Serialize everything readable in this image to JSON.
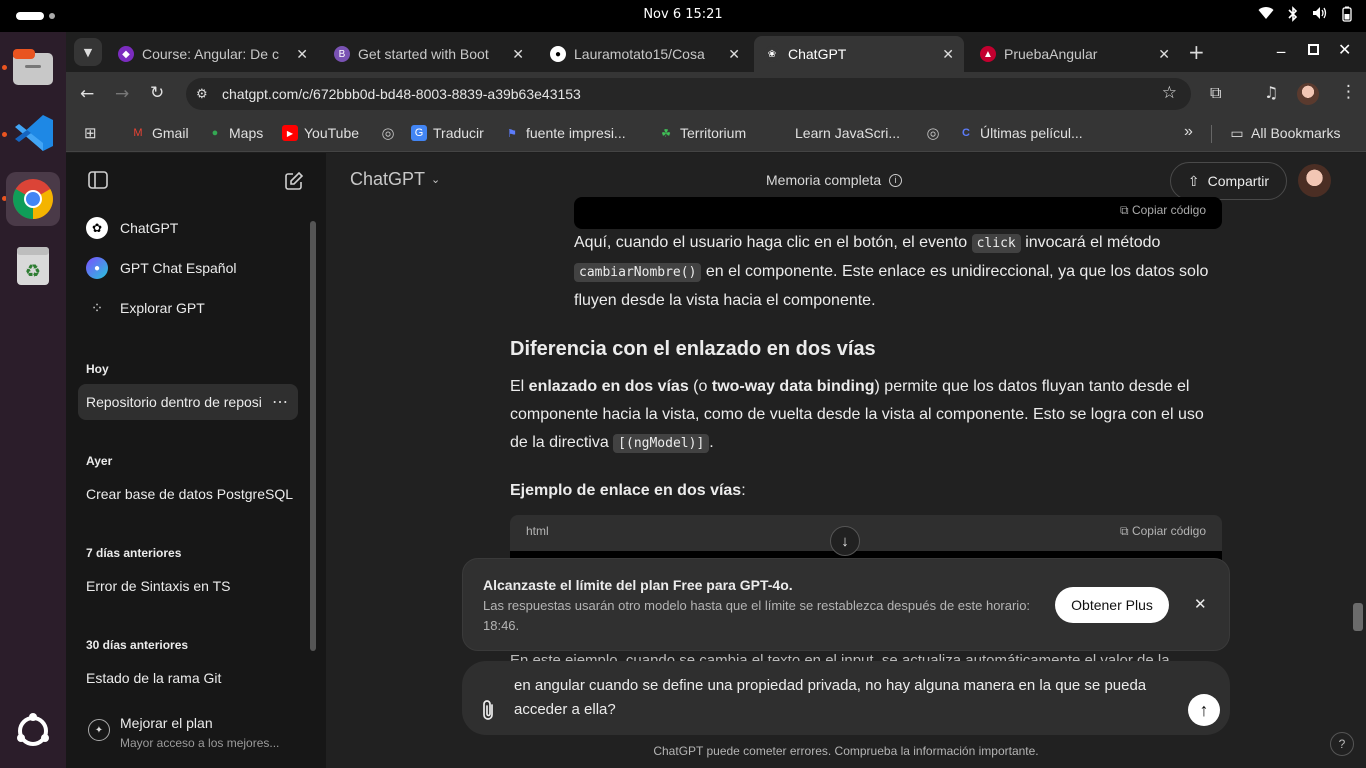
{
  "system": {
    "clock": "Nov 6  15:21"
  },
  "browser": {
    "tabs": [
      {
        "title": "Course: Angular: De c",
        "fav_color": "#7b2cbf",
        "fav_glyph": "◆"
      },
      {
        "title": "Get started with Boot",
        "fav_color": "#7952b3",
        "fav_glyph": "B"
      },
      {
        "title": "Lauramotato15/Cosa",
        "fav_color": "#ffffff",
        "fav_glyph": "●"
      },
      {
        "title": "ChatGPT",
        "fav_color": "#353535",
        "fav_glyph": "❀"
      },
      {
        "title": "PruebaAngular",
        "fav_color": "#c3002f",
        "fav_glyph": "▲"
      }
    ],
    "url": "chatgpt.com/c/672bbb0d-bd48-8003-8839-a39b63e43153",
    "bookmarks": [
      {
        "label": "Gmail",
        "icon_color": "#ea4335",
        "glyph": "M"
      },
      {
        "label": "Maps",
        "icon_color": "#34a853",
        "glyph": "●"
      },
      {
        "label": "YouTube",
        "icon_color": "#ff0000",
        "glyph": "▶"
      },
      {
        "label": "",
        "icon_color": "#9aa0a6",
        "glyph": "◎"
      },
      {
        "label": "Traducir",
        "icon_color": "#4285f4",
        "glyph": "G"
      },
      {
        "label": "fuente impresi...",
        "icon_color": "#3b5bdb",
        "glyph": "⚑"
      },
      {
        "label": "Territorium",
        "icon_color": "#2f9e44",
        "glyph": "☘"
      },
      {
        "label": "Learn JavaScri...",
        "icon_color": "#353535",
        "glyph": ""
      },
      {
        "label": "",
        "icon_color": "#9aa0a6",
        "glyph": "◎"
      },
      {
        "label": "Últimas películ...",
        "icon_color": "#3b5bdb",
        "glyph": "C"
      }
    ],
    "all_bookmarks": "All Bookmarks"
  },
  "sidebar": {
    "nav": [
      {
        "label": "ChatGPT"
      },
      {
        "label": "GPT Chat Español"
      },
      {
        "label": "Explorar GPT"
      }
    ],
    "sections": [
      {
        "heading": "Hoy",
        "items": [
          "Repositorio dentro de reposi"
        ]
      },
      {
        "heading": "Ayer",
        "items": [
          "Crear base de datos PostgreSQL"
        ]
      },
      {
        "heading": "7 días anteriores",
        "items": [
          "Error de Sintaxis en TS"
        ]
      },
      {
        "heading": "30 días anteriores",
        "items": [
          "Estado de la rama Git"
        ]
      }
    ],
    "upgrade": {
      "title": "Mejorar el plan",
      "subtitle": "Mayor acceso a los mejores..."
    }
  },
  "header": {
    "model": "ChatGPT",
    "memory": "Memoria completa",
    "share": "Compartir"
  },
  "content": {
    "copy_code": "Copiar código",
    "para1_a": "Aquí, cuando el usuario haga clic en el botón, el evento ",
    "para1_code1": "click",
    "para1_b": " invocará el método",
    "para1_code2": "cambiarNombre()",
    "para1_c": " en el componente. Este enlace es unidireccional, ya que los datos solo fluyen desde la vista hacia el componente.",
    "heading": "Diferencia con el enlazado en dos vías",
    "para2_a": "El ",
    "para2_b1": "enlazado en dos vías",
    "para2_b": " (o ",
    "para2_b2": "two-way data binding",
    "para2_c": ") permite que los datos fluyan tanto desde el componente hacia la vista, como de vuelta desde la vista al componente. Esto se logra con el uso de la directiva ",
    "para2_code": "[(ngModel)]",
    "para2_d": ".",
    "example_label": "Ejemplo de enlace en dos vías",
    "example_colon": ":",
    "code_lang": "html",
    "partial_line": "En este ejemplo, cuando se cambia el texto en el input, se actualiza automáticamente el valor de la propiedad"
  },
  "limit_banner": {
    "title": "Alcanzaste el límite del plan Free para GPT-4o.",
    "body": "Las respuestas usarán otro modelo hasta que el límite se restablezca después de este horario: 18:46.",
    "cta": "Obtener Plus"
  },
  "composer": {
    "text": "en angular cuando se define una propiedad privada, no hay alguna manera en la que se pueda acceder a ella?"
  },
  "footer": {
    "disclaimer": "ChatGPT puede cometer errores. Comprueba la información importante.",
    "help": "?"
  }
}
